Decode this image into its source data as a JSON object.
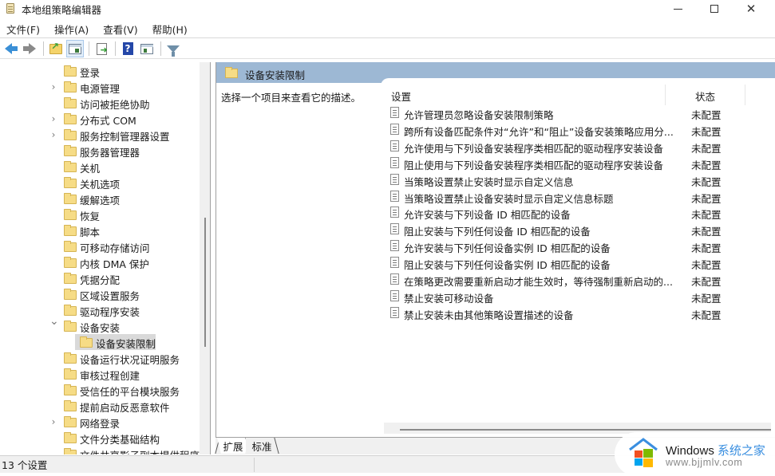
{
  "window": {
    "title": "本地组策略编辑器",
    "controls": {
      "minimize": "minimize",
      "maximize": "maximize",
      "close": "✕"
    }
  },
  "menu": [
    {
      "label": "文件(F)"
    },
    {
      "label": "操作(A)"
    },
    {
      "label": "查看(V)"
    },
    {
      "label": "帮助(H)"
    }
  ],
  "toolbar": [
    {
      "icon": "back-arrow-icon"
    },
    {
      "icon": "forward-arrow-icon"
    },
    {
      "icon": "up-one-level-icon"
    },
    {
      "icon": "show-hide-console-tree-icon",
      "active": true
    },
    {
      "icon": "export-list-icon"
    },
    {
      "icon": "help-icon"
    },
    {
      "icon": "show-hide-action-pane-icon"
    },
    {
      "icon": "filter-icon"
    }
  ],
  "tree": {
    "items": [
      {
        "label": "登录",
        "expandable": false
      },
      {
        "label": "电源管理",
        "expandable": true
      },
      {
        "label": "访问被拒绝协助",
        "expandable": false
      },
      {
        "label": "分布式 COM",
        "expandable": true
      },
      {
        "label": "服务控制管理器设置",
        "expandable": true
      },
      {
        "label": "服务器管理器",
        "expandable": false
      },
      {
        "label": "关机",
        "expandable": false
      },
      {
        "label": "关机选项",
        "expandable": false
      },
      {
        "label": "缓解选项",
        "expandable": false
      },
      {
        "label": "恢复",
        "expandable": false
      },
      {
        "label": "脚本",
        "expandable": false
      },
      {
        "label": "可移动存储访问",
        "expandable": false
      },
      {
        "label": "内核 DMA 保护",
        "expandable": false
      },
      {
        "label": "凭据分配",
        "expandable": false
      },
      {
        "label": "区域设置服务",
        "expandable": false
      },
      {
        "label": "驱动程序安装",
        "expandable": false
      },
      {
        "label": "设备安装",
        "expandable": true,
        "expanded": true
      },
      {
        "label": "设备安装限制",
        "child": true,
        "selected": true
      },
      {
        "label": "设备运行状况证明服务",
        "expandable": false
      },
      {
        "label": "审核过程创建",
        "expandable": false
      },
      {
        "label": "受信任的平台模块服务",
        "expandable": false
      },
      {
        "label": "提前启动反恶意软件",
        "expandable": false
      },
      {
        "label": "网络登录",
        "expandable": true
      },
      {
        "label": "文件分类基础结构",
        "expandable": false
      },
      {
        "label": "文件共享影子副本提供程序",
        "expandable": false
      }
    ]
  },
  "details": {
    "header_title": "设备安装限制",
    "description": "选择一个项目来查看它的描述。",
    "columns": {
      "setting": "设置",
      "state": "状态"
    },
    "rows": [
      {
        "name": "允许管理员忽略设备安装限制策略",
        "state": "未配置"
      },
      {
        "name": "跨所有设备匹配条件对“允许”和“阻止”设备安装策略应用分...",
        "state": "未配置"
      },
      {
        "name": "允许使用与下列设备安装程序类相匹配的驱动程序安装设备",
        "state": "未配置"
      },
      {
        "name": "阻止使用与下列设备安装程序类相匹配的驱动程序安装设备",
        "state": "未配置"
      },
      {
        "name": "当策略设置禁止安装时显示自定义信息",
        "state": "未配置"
      },
      {
        "name": "当策略设置禁止设备安装时显示自定义信息标题",
        "state": "未配置"
      },
      {
        "name": "允许安装与下列设备 ID 相匹配的设备",
        "state": "未配置"
      },
      {
        "name": "阻止安装与下列任何设备 ID 相匹配的设备",
        "state": "未配置"
      },
      {
        "name": "允许安装与下列任何设备实例 ID 相匹配的设备",
        "state": "未配置"
      },
      {
        "name": "阻止安装与下列任何设备实例 ID 相匹配的设备",
        "state": "未配置"
      },
      {
        "name": "在策略更改需要重新启动才能生效时，等待强制重新启动的...",
        "state": "未配置"
      },
      {
        "name": "禁止安装可移动设备",
        "state": "未配置"
      },
      {
        "name": "禁止安装未由其他策略设置描述的设备",
        "state": "未配置"
      }
    ]
  },
  "tabs": [
    {
      "label": "扩展",
      "active": true
    },
    {
      "label": "标准",
      "active": false
    }
  ],
  "status": {
    "text": "13 个设置"
  },
  "watermark": {
    "title": "Windows",
    "title_cn": "系统之家",
    "url": "www.bjjmlv.com",
    "colors": {
      "red": "#f25022",
      "green": "#7fba00",
      "blue": "#00a4ef",
      "yellow": "#ffb900",
      "roof": "#3a8fe0"
    }
  }
}
